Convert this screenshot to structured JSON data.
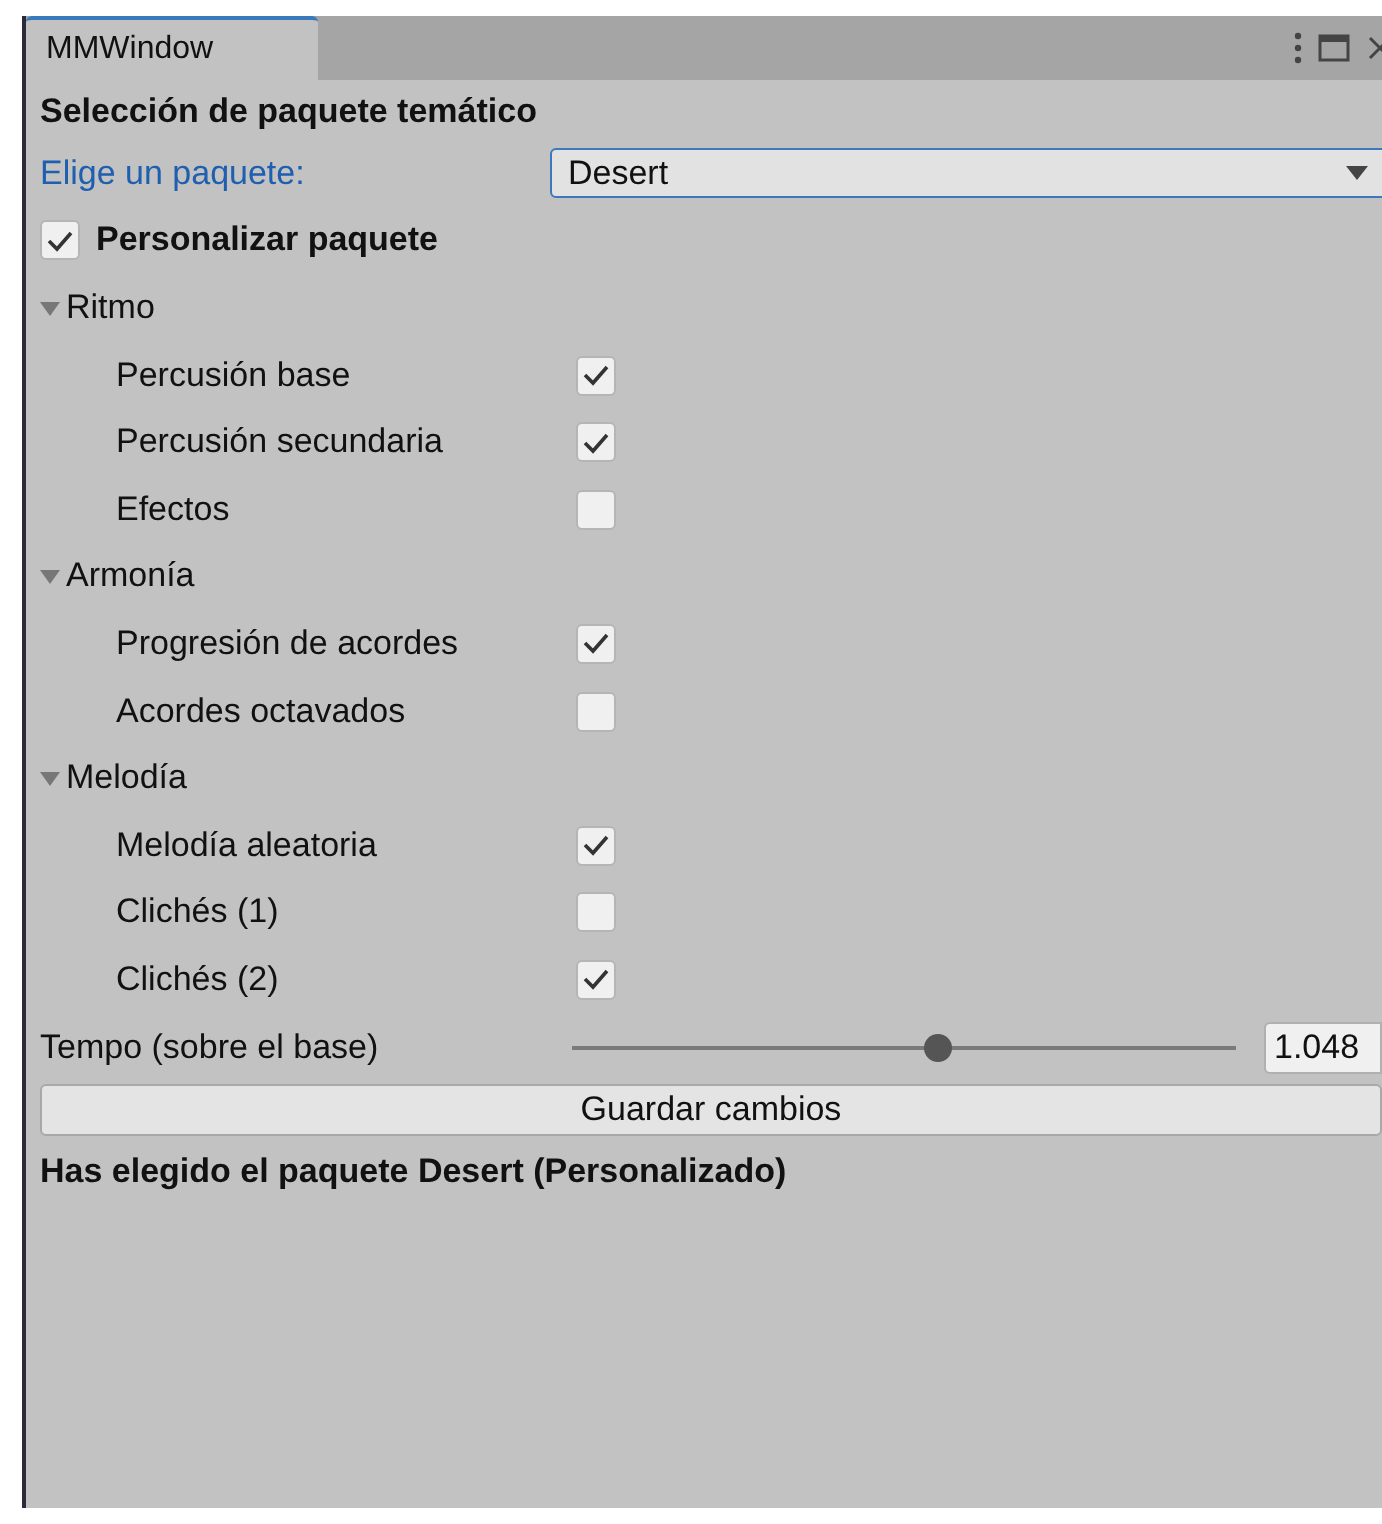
{
  "window": {
    "tab": {
      "label": "MMWindow",
      "selected": true
    }
  },
  "heading": "Selección de paquete temático",
  "package_select": {
    "label": "Elige un paquete:",
    "value": "Desert"
  },
  "customize": {
    "label": "Personalizar paquete",
    "checked": true
  },
  "groups": [
    {
      "title": "Ritmo",
      "expanded": true,
      "items": [
        {
          "label": "Percusión base",
          "checked": true
        },
        {
          "label": "Percusión secundaria",
          "checked": true
        },
        {
          "label": "Efectos",
          "checked": false
        }
      ]
    },
    {
      "title": "Armonía",
      "expanded": true,
      "items": [
        {
          "label": "Progresión de acordes",
          "checked": true
        },
        {
          "label": "Acordes octavados",
          "checked": false
        }
      ]
    },
    {
      "title": "Melodía",
      "expanded": true,
      "items": [
        {
          "label": "Melodía aleatoria",
          "checked": true
        },
        {
          "label": "Clichés (1)",
          "checked": false
        },
        {
          "label": "Clichés (2)",
          "checked": true
        }
      ]
    }
  ],
  "tempo": {
    "label": "Tempo (sobre el base)",
    "level": 0.55,
    "value": "1.048"
  },
  "save_button": "Guardar cambios",
  "status": "Has elegido el paquete Desert (Personalizado)"
}
